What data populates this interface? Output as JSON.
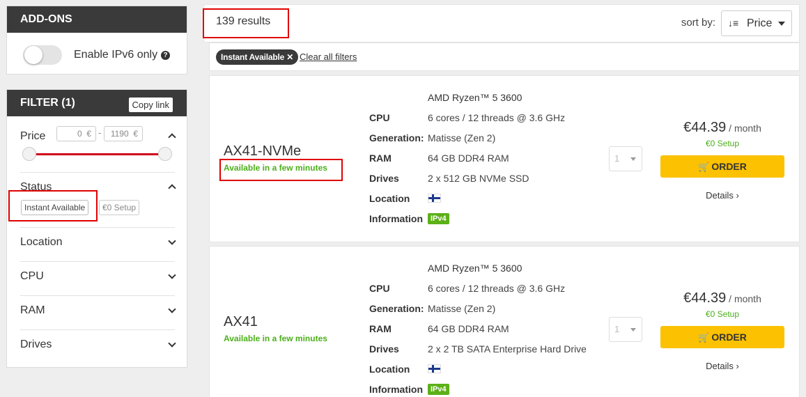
{
  "addons": {
    "title": "ADD-ONS",
    "ipv6_label": "Enable IPv6 only",
    "ipv6_enabled": false
  },
  "filter": {
    "title": "FILTER (1)",
    "copy_link": "Copy link",
    "price": {
      "label": "Price",
      "min": "0",
      "max": "1190",
      "currency": "€",
      "separator": "-"
    },
    "status": {
      "label": "Status",
      "options": [
        "Instant Available",
        "€0 Setup"
      ]
    },
    "sections": [
      "Location",
      "CPU",
      "RAM",
      "Drives"
    ]
  },
  "results": {
    "count_text": "139 results"
  },
  "sort": {
    "label": "sort by:",
    "value": "Price"
  },
  "active_filter": {
    "chip": "Instant Available",
    "close": "✕",
    "clear_all": "Clear all filters"
  },
  "spec_keys": {
    "cpu": "CPU",
    "generation": "Generation:",
    "ram": "RAM",
    "drives": "Drives",
    "location": "Location",
    "information": "Information"
  },
  "servers": [
    {
      "name": "AX41-NVMe",
      "availability": "Available in a few minutes",
      "cpu_model": "AMD Ryzen™ 5 3600",
      "cpu": "6 cores / 12 threads @ 3.6 GHz",
      "generation": "Matisse (Zen 2)",
      "ram": "64 GB DDR4 RAM",
      "drives": "2 x 512 GB NVMe SSD",
      "location_flag": "finland-flag-icon",
      "information": "IPv4",
      "quantity": "1",
      "price": "€44.39",
      "per": " / month",
      "setup": "€0 Setup",
      "order": "ORDER",
      "details": "Details ›"
    },
    {
      "name": "AX41",
      "availability": "Available in a few minutes",
      "cpu_model": "AMD Ryzen™ 5 3600",
      "cpu": "6 cores / 12 threads @ 3.6 GHz",
      "generation": "Matisse (Zen 2)",
      "ram": "64 GB DDR4 RAM",
      "drives": "2 x 2 TB SATA Enterprise Hard Drive",
      "location_flag": "finland-flag-icon",
      "information": "IPv4",
      "quantity": "1",
      "price": "€44.39",
      "per": " / month",
      "setup": "€0 Setup",
      "order": "ORDER",
      "details": "Details ›"
    }
  ],
  "colors": {
    "accent_red": "#d0021b",
    "order_yellow": "#fcc100",
    "available_green": "#4caf1a",
    "header_dark": "#3a3a3a",
    "highlight_box": "#e00000"
  }
}
